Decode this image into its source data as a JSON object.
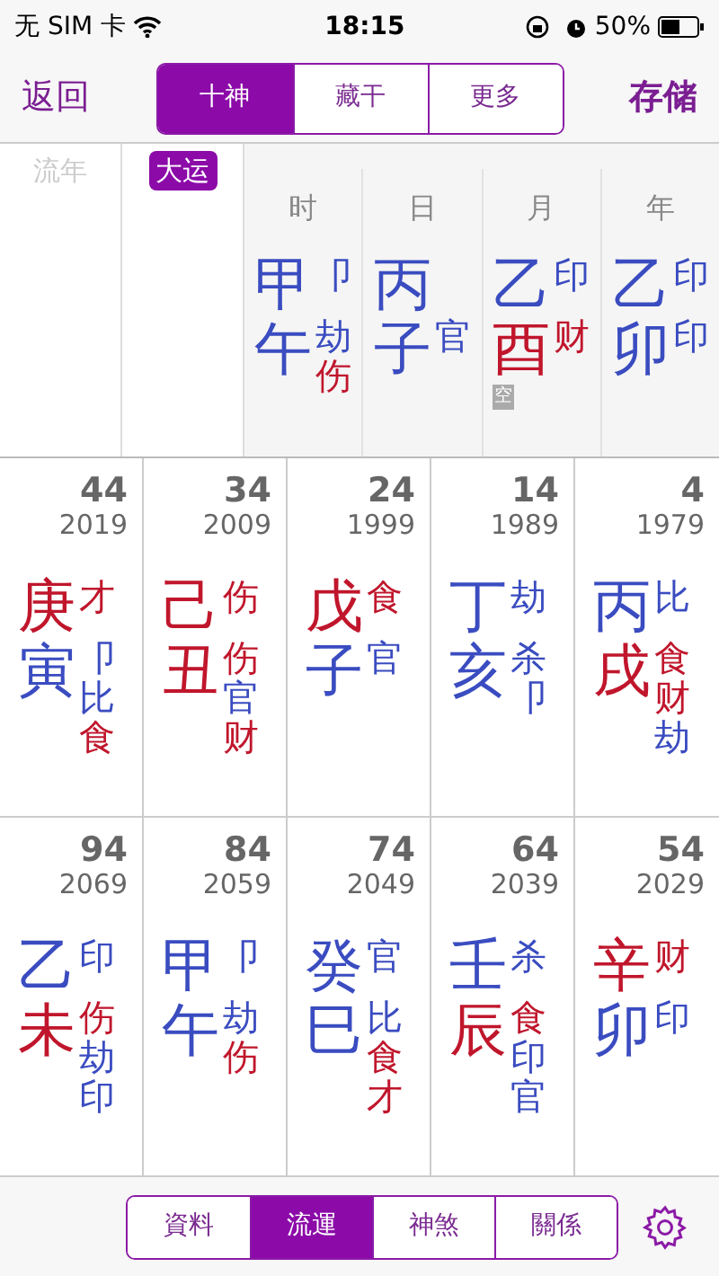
{
  "status_bar": {
    "carrier": "无 SIM 卡",
    "time": "18:15",
    "battery": "50%"
  },
  "nav": {
    "back": "返回",
    "save": "存储",
    "segments": [
      {
        "label": "十神",
        "selected": true
      },
      {
        "label": "藏干",
        "selected": false
      },
      {
        "label": "更多",
        "selected": false
      }
    ]
  },
  "column_tabs": [
    {
      "label": "流年",
      "selected": false
    },
    {
      "label": "大运",
      "selected": true
    }
  ],
  "pillars": [
    {
      "label": "时",
      "stem": {
        "char": "甲",
        "color": "#3a4cc0"
      },
      "branch": {
        "char": "午",
        "color": "#3a4cc0"
      },
      "stem_gods": [
        {
          "text": "卩",
          "color": "#3a4cc0"
        }
      ],
      "branch_gods": [
        {
          "text": "劫",
          "color": "#3a4cc0"
        },
        {
          "text": "伤",
          "color": "#c0162c"
        }
      ]
    },
    {
      "label": "日",
      "stem": {
        "char": "丙",
        "color": "#3a4cc0"
      },
      "branch": {
        "char": "子",
        "color": "#3a4cc0"
      },
      "branch_gods": [
        {
          "text": "官",
          "color": "#3a4cc0"
        }
      ]
    },
    {
      "label": "月",
      "stem": {
        "char": "乙",
        "color": "#3a4cc0"
      },
      "branch": {
        "char": "酉",
        "color": "#c0162c"
      },
      "stem_gods": [
        {
          "text": "印",
          "color": "#3a4cc0"
        }
      ],
      "branch_gods": [
        {
          "text": "财",
          "color": "#c0162c"
        }
      ],
      "void": "空"
    },
    {
      "label": "年",
      "stem": {
        "char": "乙",
        "color": "#3a4cc0"
      },
      "branch": {
        "char": "卯",
        "color": "#3a4cc0"
      },
      "stem_gods": [
        {
          "text": "印",
          "color": "#3a4cc0"
        }
      ],
      "branch_gods": [
        {
          "text": "印",
          "color": "#3a4cc0"
        }
      ]
    }
  ],
  "cycles": [
    {
      "age": "44",
      "year": "2019",
      "stem": {
        "char": "庚",
        "color": "#c0162c"
      },
      "branch": {
        "char": "寅",
        "color": "#3a4cc0"
      },
      "stem_gods": [
        {
          "text": "才",
          "color": "#c0162c"
        }
      ],
      "branch_gods": [
        {
          "text": "卩",
          "color": "#3a4cc0"
        },
        {
          "text": "比",
          "color": "#3a4cc0"
        },
        {
          "text": "食",
          "color": "#c0162c"
        }
      ]
    },
    {
      "age": "34",
      "year": "2009",
      "stem": {
        "char": "己",
        "color": "#c0162c"
      },
      "branch": {
        "char": "丑",
        "color": "#c0162c"
      },
      "stem_gods": [
        {
          "text": "伤",
          "color": "#c0162c"
        }
      ],
      "branch_gods": [
        {
          "text": "伤",
          "color": "#c0162c"
        },
        {
          "text": "官",
          "color": "#3a4cc0"
        },
        {
          "text": "财",
          "color": "#c0162c"
        }
      ]
    },
    {
      "age": "24",
      "year": "1999",
      "stem": {
        "char": "戊",
        "color": "#c0162c"
      },
      "branch": {
        "char": "子",
        "color": "#3a4cc0"
      },
      "stem_gods": [
        {
          "text": "食",
          "color": "#c0162c"
        }
      ],
      "branch_gods": [
        {
          "text": "官",
          "color": "#3a4cc0"
        }
      ]
    },
    {
      "age": "14",
      "year": "1989",
      "stem": {
        "char": "丁",
        "color": "#3a4cc0"
      },
      "branch": {
        "char": "亥",
        "color": "#3a4cc0"
      },
      "stem_gods": [
        {
          "text": "劫",
          "color": "#3a4cc0"
        }
      ],
      "branch_gods": [
        {
          "text": "杀",
          "color": "#3a4cc0"
        },
        {
          "text": "卩",
          "color": "#3a4cc0"
        }
      ]
    },
    {
      "age": "4",
      "year": "1979",
      "stem": {
        "char": "丙",
        "color": "#3a4cc0"
      },
      "branch": {
        "char": "戌",
        "color": "#c0162c"
      },
      "stem_gods": [
        {
          "text": "比",
          "color": "#3a4cc0"
        }
      ],
      "branch_gods": [
        {
          "text": "食",
          "color": "#c0162c"
        },
        {
          "text": "财",
          "color": "#c0162c"
        },
        {
          "text": "劫",
          "color": "#3a4cc0"
        }
      ]
    },
    {
      "age": "94",
      "year": "2069",
      "stem": {
        "char": "乙",
        "color": "#3a4cc0"
      },
      "branch": {
        "char": "未",
        "color": "#c0162c"
      },
      "stem_gods": [
        {
          "text": "印",
          "color": "#3a4cc0"
        }
      ],
      "branch_gods": [
        {
          "text": "伤",
          "color": "#c0162c"
        },
        {
          "text": "劫",
          "color": "#3a4cc0"
        },
        {
          "text": "印",
          "color": "#3a4cc0"
        }
      ]
    },
    {
      "age": "84",
      "year": "2059",
      "stem": {
        "char": "甲",
        "color": "#3a4cc0"
      },
      "branch": {
        "char": "午",
        "color": "#3a4cc0"
      },
      "stem_gods": [
        {
          "text": "卩",
          "color": "#3a4cc0"
        }
      ],
      "branch_gods": [
        {
          "text": "劫",
          "color": "#3a4cc0"
        },
        {
          "text": "伤",
          "color": "#c0162c"
        }
      ]
    },
    {
      "age": "74",
      "year": "2049",
      "stem": {
        "char": "癸",
        "color": "#3a4cc0"
      },
      "branch": {
        "char": "巳",
        "color": "#3a4cc0"
      },
      "stem_gods": [
        {
          "text": "官",
          "color": "#3a4cc0"
        }
      ],
      "branch_gods": [
        {
          "text": "比",
          "color": "#3a4cc0"
        },
        {
          "text": "食",
          "color": "#c0162c"
        },
        {
          "text": "才",
          "color": "#c0162c"
        }
      ]
    },
    {
      "age": "64",
      "year": "2039",
      "stem": {
        "char": "壬",
        "color": "#3a4cc0"
      },
      "branch": {
        "char": "辰",
        "color": "#c0162c"
      },
      "stem_gods": [
        {
          "text": "杀",
          "color": "#3a4cc0"
        }
      ],
      "branch_gods": [
        {
          "text": "食",
          "color": "#c0162c"
        },
        {
          "text": "印",
          "color": "#3a4cc0"
        },
        {
          "text": "官",
          "color": "#3a4cc0"
        }
      ]
    },
    {
      "age": "54",
      "year": "2029",
      "stem": {
        "char": "辛",
        "color": "#c0162c"
      },
      "branch": {
        "char": "卯",
        "color": "#3a4cc0"
      },
      "stem_gods": [
        {
          "text": "财",
          "color": "#c0162c"
        }
      ],
      "branch_gods": [
        {
          "text": "印",
          "color": "#3a4cc0"
        }
      ]
    }
  ],
  "bottom_tabs": [
    {
      "label": "資料",
      "selected": false
    },
    {
      "label": "流運",
      "selected": true
    },
    {
      "label": "神煞",
      "selected": false
    },
    {
      "label": "關係",
      "selected": false
    }
  ]
}
